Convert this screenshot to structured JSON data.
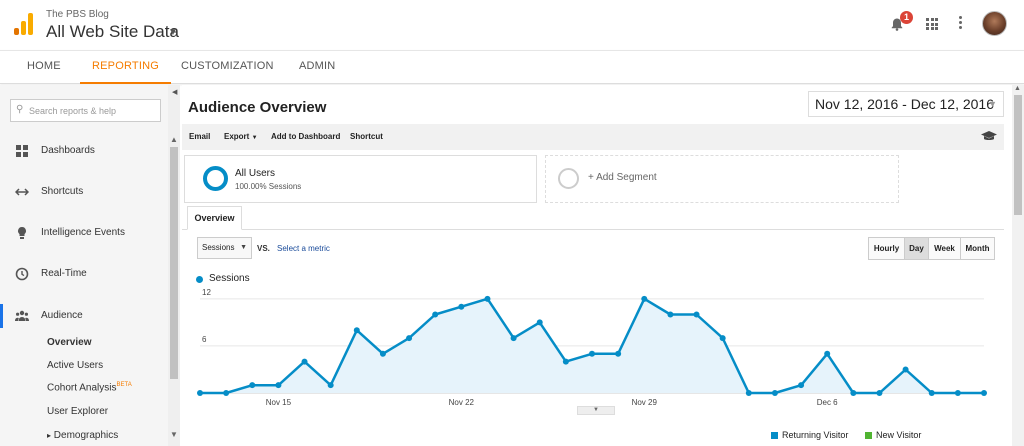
{
  "header": {
    "account_name": "The PBS Blog",
    "property_name": "All Web Site Data",
    "notification_count": "1"
  },
  "nav": {
    "tabs": [
      {
        "label": "HOME",
        "active": false
      },
      {
        "label": "REPORTING",
        "active": true
      },
      {
        "label": "CUSTOMIZATION",
        "active": false
      },
      {
        "label": "ADMIN",
        "active": false
      }
    ]
  },
  "sidebar": {
    "search_placeholder": "Search reports & help",
    "items": [
      {
        "label": "Dashboards",
        "icon": "dashboards-icon"
      },
      {
        "label": "Shortcuts",
        "icon": "shortcuts-icon"
      },
      {
        "label": "Intelligence Events",
        "icon": "lightbulb-icon"
      },
      {
        "label": "Real-Time",
        "icon": "clock-icon"
      },
      {
        "label": "Audience",
        "icon": "people-icon",
        "active": true
      }
    ],
    "sub_items": [
      {
        "label": "Overview",
        "selected": true
      },
      {
        "label": "Active Users"
      },
      {
        "label": "Cohort Analysis",
        "badge": "BETA"
      },
      {
        "label": "User Explorer"
      },
      {
        "label": "Demographics",
        "prefix": "▸"
      }
    ]
  },
  "main": {
    "title": "Audience Overview",
    "date_range": "Nov 12, 2016 - Dec 12, 2016",
    "toolbar": {
      "email": "Email",
      "export": "Export",
      "add_to_dashboard": "Add to Dashboard",
      "shortcut": "Shortcut"
    },
    "segment": {
      "title": "All Users",
      "subtitle": "100.00% Sessions",
      "add_label": "+ Add Segment"
    },
    "tab_label": "Overview",
    "metric_select": "Sessions",
    "vs_label": "VS.",
    "select_metric": "Select a metric",
    "granularity": [
      {
        "label": "Hourly",
        "active": false
      },
      {
        "label": "Day",
        "active": true
      },
      {
        "label": "Week",
        "active": false
      },
      {
        "label": "Month",
        "active": false
      }
    ],
    "visitor_legend": [
      {
        "label": "Returning Visitor",
        "color": "#058dc7"
      },
      {
        "label": "New Visitor",
        "color": "#50b432"
      }
    ]
  },
  "colors": {
    "accent": "#f57c00",
    "series": "#058dc7",
    "area": "#e6f3fb"
  },
  "chart_data": {
    "type": "area",
    "series": [
      {
        "name": "Sessions",
        "values": [
          0,
          0,
          1,
          1,
          4,
          1,
          8,
          5,
          7,
          10,
          11,
          12,
          7,
          9,
          4,
          5,
          5,
          12,
          10,
          10,
          7,
          0,
          0,
          1,
          5,
          0,
          0,
          3,
          0,
          0,
          0
        ]
      }
    ],
    "x_tick_labels": [
      {
        "index": 3,
        "label": "Nov 15"
      },
      {
        "index": 10,
        "label": "Nov 22"
      },
      {
        "index": 17,
        "label": "Nov 29"
      },
      {
        "index": 24,
        "label": "Dec 6"
      }
    ],
    "y_ticks": [
      6,
      12
    ],
    "ylim": [
      0,
      13
    ],
    "grid": true
  }
}
